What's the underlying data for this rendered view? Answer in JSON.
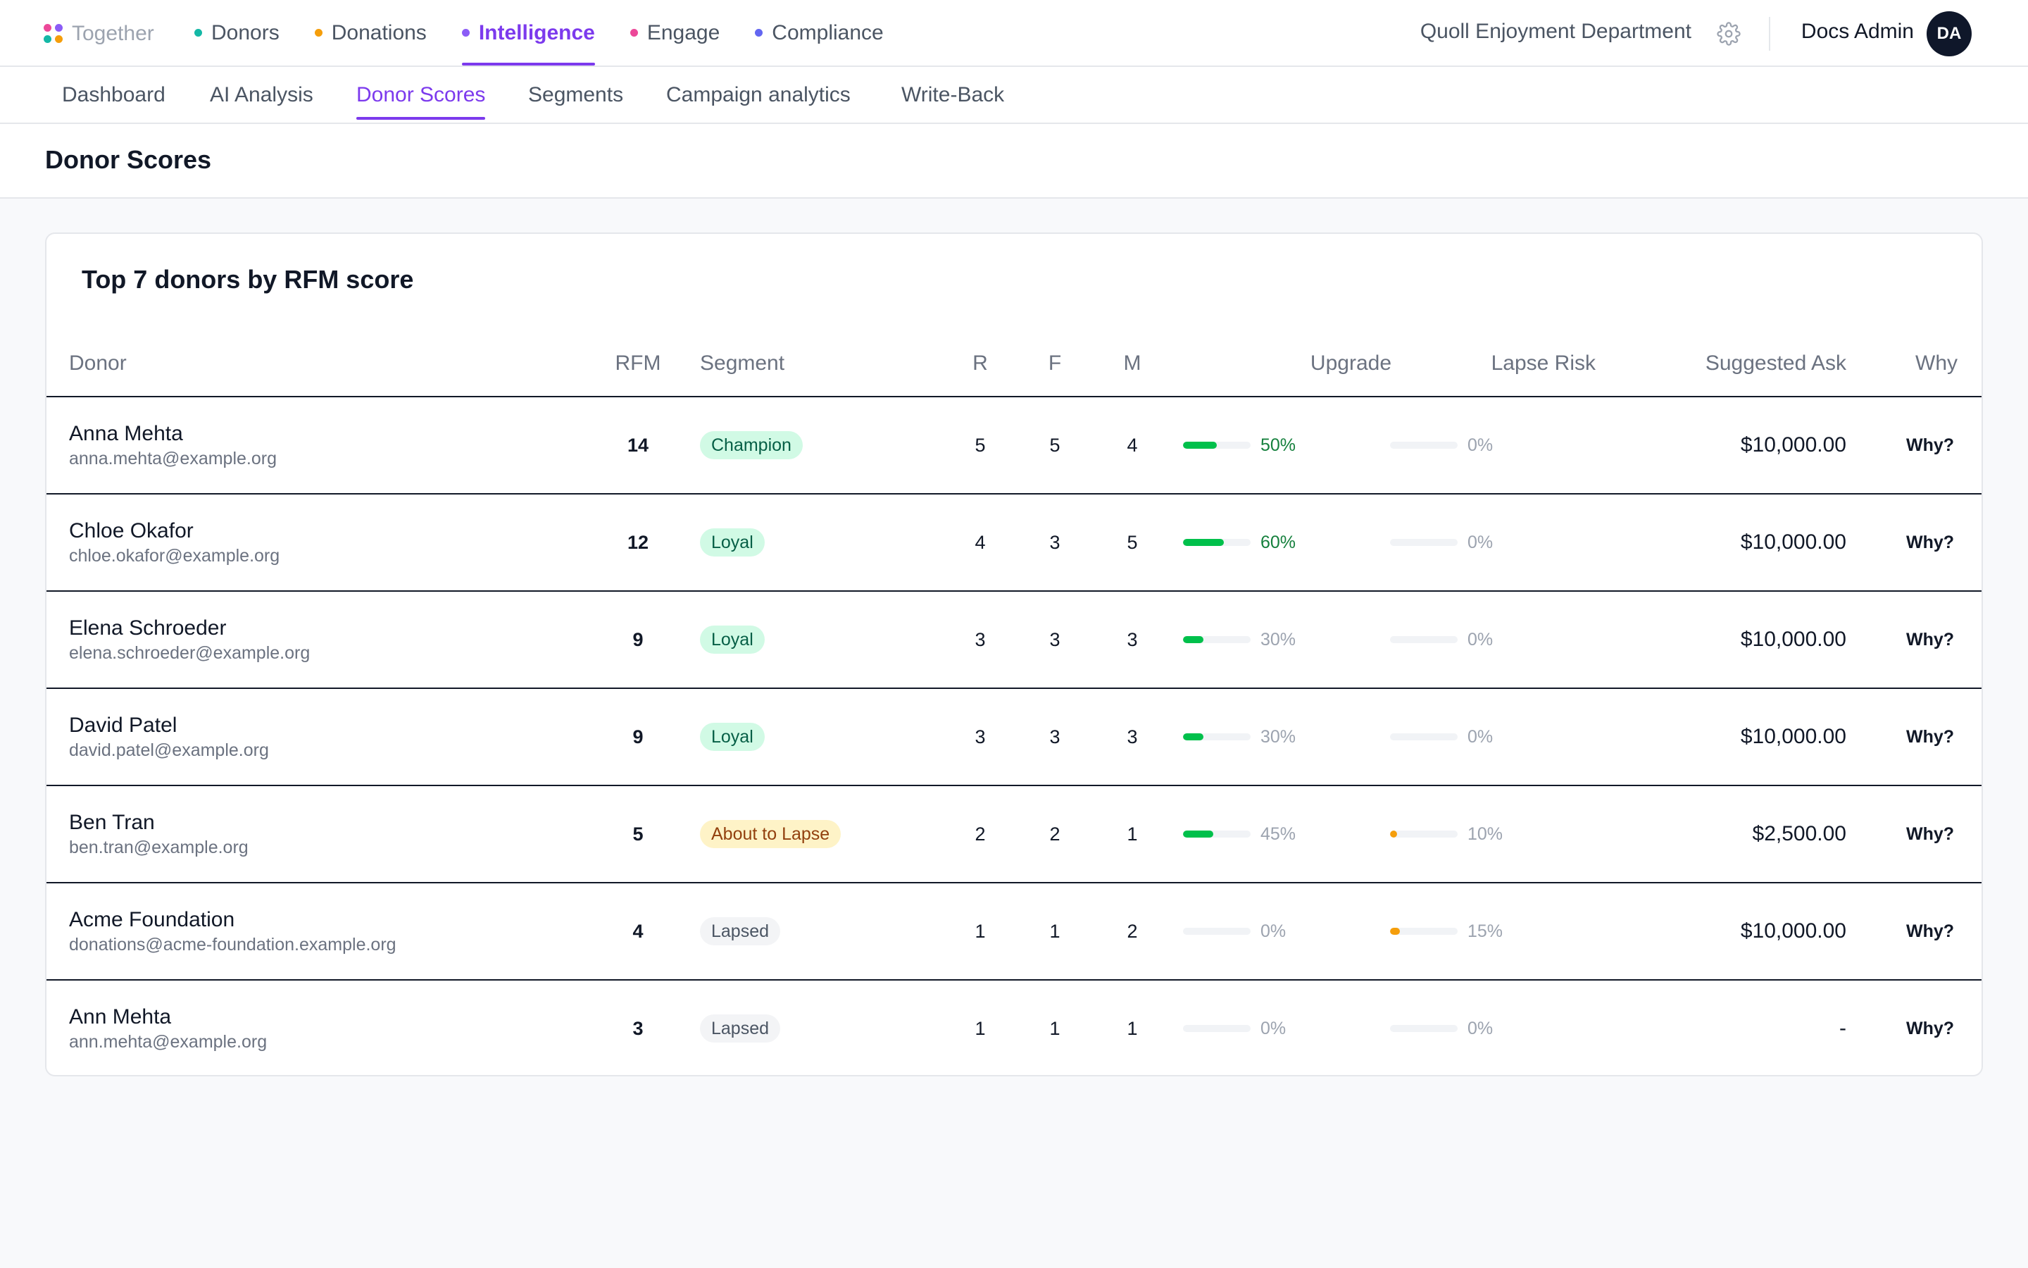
{
  "brand": {
    "name": "Together"
  },
  "main_nav": [
    {
      "label": "Donors",
      "color": "#14b8a6",
      "active": false
    },
    {
      "label": "Donations",
      "color": "#f59e0b",
      "active": false
    },
    {
      "label": "Intelligence",
      "color": "#8b5cf6",
      "active": true
    },
    {
      "label": "Engage",
      "color": "#ec4899",
      "active": false
    },
    {
      "label": "Compliance",
      "color": "#6366f1",
      "active": false
    }
  ],
  "header": {
    "org_name": "Quoll Enjoyment Department",
    "settings_icon": "gear-icon",
    "user_name": "Docs Admin",
    "user_initials": "DA"
  },
  "sub_nav": [
    {
      "label": "Dashboard",
      "active": false
    },
    {
      "label": "AI Analysis",
      "active": false
    },
    {
      "label": "Donor Scores",
      "active": true
    },
    {
      "label": "Segments",
      "active": false
    },
    {
      "label": "Campaign analytics",
      "active": false
    },
    {
      "label": "Write-Back",
      "active": false
    }
  ],
  "page": {
    "title": "Donor Scores"
  },
  "table": {
    "title": "Top 7 donors by RFM score",
    "columns": {
      "donor": "Donor",
      "rfm": "RFM",
      "segment": "Segment",
      "r": "R",
      "f": "F",
      "m": "M",
      "upgrade": "Upgrade",
      "lapse_risk": "Lapse Risk",
      "suggested_ask": "Suggested Ask",
      "why": "Why"
    },
    "colors": {
      "upgrade_high": "#00c04b",
      "upgrade_low": "#00c04b",
      "lapse": "#f59e0b",
      "pct_green": "#15803d",
      "pct_muted": "#9ca3af"
    },
    "rows": [
      {
        "name": "Anna Mehta",
        "email": "anna.mehta@example.org",
        "rfm": "14",
        "segment": "Champion",
        "segment_style": "champion",
        "r": "5",
        "f": "5",
        "m": "4",
        "upgrade": 50,
        "upgrade_label": "50%",
        "lapse": 0,
        "lapse_label": "0%",
        "ask": "$10,000.00",
        "why": "Why?"
      },
      {
        "name": "Chloe Okafor",
        "email": "chloe.okafor@example.org",
        "rfm": "12",
        "segment": "Loyal",
        "segment_style": "loyal",
        "r": "4",
        "f": "3",
        "m": "5",
        "upgrade": 60,
        "upgrade_label": "60%",
        "lapse": 0,
        "lapse_label": "0%",
        "ask": "$10,000.00",
        "why": "Why?"
      },
      {
        "name": "Elena Schroeder",
        "email": "elena.schroeder@example.org",
        "rfm": "9",
        "segment": "Loyal",
        "segment_style": "loyal",
        "r": "3",
        "f": "3",
        "m": "3",
        "upgrade": 30,
        "upgrade_label": "30%",
        "lapse": 0,
        "lapse_label": "0%",
        "ask": "$10,000.00",
        "why": "Why?"
      },
      {
        "name": "David Patel",
        "email": "david.patel@example.org",
        "rfm": "9",
        "segment": "Loyal",
        "segment_style": "loyal",
        "r": "3",
        "f": "3",
        "m": "3",
        "upgrade": 30,
        "upgrade_label": "30%",
        "lapse": 0,
        "lapse_label": "0%",
        "ask": "$10,000.00",
        "why": "Why?"
      },
      {
        "name": "Ben Tran",
        "email": "ben.tran@example.org",
        "rfm": "5",
        "segment": "About to Lapse",
        "segment_style": "about",
        "r": "2",
        "f": "2",
        "m": "1",
        "upgrade": 45,
        "upgrade_label": "45%",
        "lapse": 10,
        "lapse_label": "10%",
        "ask": "$2,500.00",
        "why": "Why?"
      },
      {
        "name": "Acme Foundation",
        "email": "donations@acme-foundation.example.org",
        "rfm": "4",
        "segment": "Lapsed",
        "segment_style": "lapsed",
        "r": "1",
        "f": "1",
        "m": "2",
        "upgrade": 0,
        "upgrade_label": "0%",
        "lapse": 15,
        "lapse_label": "15%",
        "ask": "$10,000.00",
        "why": "Why?"
      },
      {
        "name": "Ann Mehta",
        "email": "ann.mehta@example.org",
        "rfm": "3",
        "segment": "Lapsed",
        "segment_style": "lapsed",
        "r": "1",
        "f": "1",
        "m": "1",
        "upgrade": 0,
        "upgrade_label": "0%",
        "lapse": 0,
        "lapse_label": "0%",
        "ask": "-",
        "why": "Why?"
      }
    ]
  }
}
